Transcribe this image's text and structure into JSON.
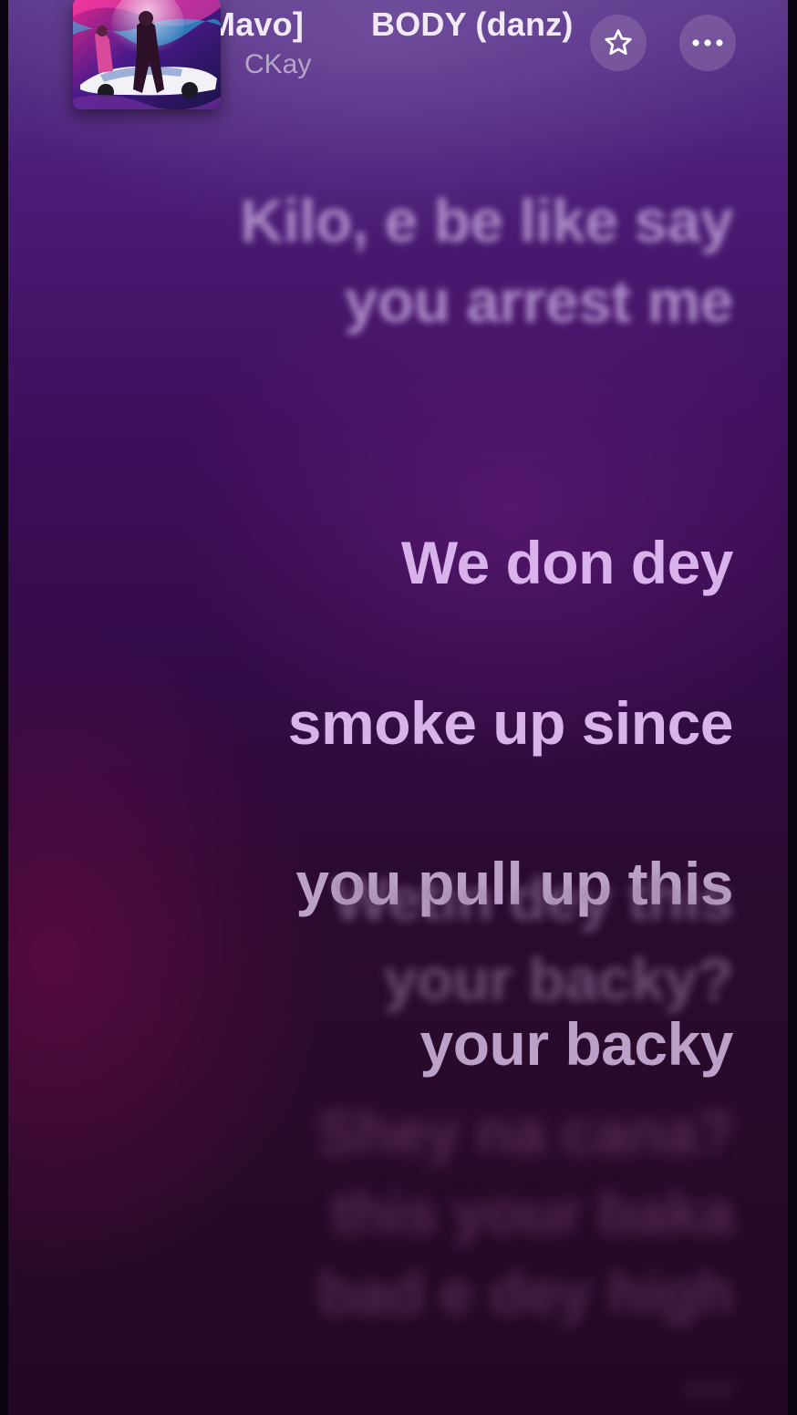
{
  "now_playing": {
    "title_previous_fragment": "Mavo]",
    "title": "BODY (danz)",
    "artist": "CKay"
  },
  "header_actions": {
    "favorite_icon": "star-outline-icon",
    "more_icon": "ellipsis-icon"
  },
  "lyrics": [
    {
      "text": "Kilo, e be like say\nyou arrest me",
      "state": "past"
    },
    {
      "text_line1": "We don dey",
      "text_line2": "smoke up since",
      "text_line3": "you pull up this",
      "text_line4": "your backy",
      "state": "current"
    },
    {
      "text": "Wetin dey this\nyour backy?",
      "state": "upcoming"
    },
    {
      "text": "Shey na cana?\nthis your baka\nbad e dey high\n...",
      "state": "upcoming"
    }
  ],
  "colors": {
    "background_top": "#5c3a8c",
    "background_bottom": "#220822",
    "active_lyric": "#d9b2ec",
    "button_bg": "#8c6eaa"
  }
}
